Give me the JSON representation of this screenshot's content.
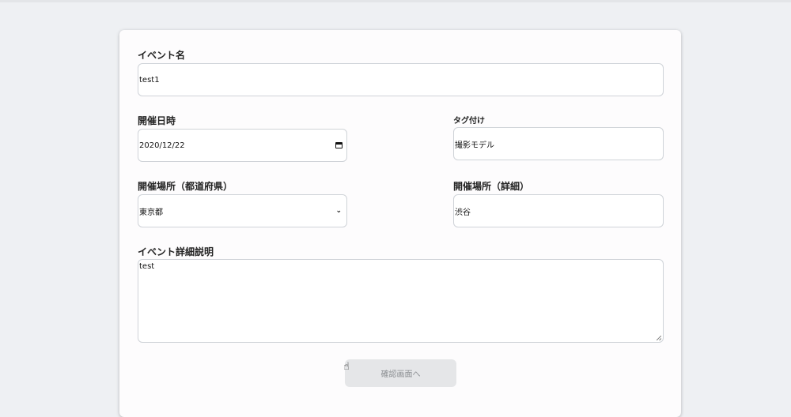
{
  "form": {
    "event_name": {
      "label": "イベント名",
      "value": "test1"
    },
    "date": {
      "label": "開催日時",
      "value": "2020/12/22",
      "icon": "calendar-icon"
    },
    "tags": {
      "label": "タグ付け",
      "value": "撮影モデル"
    },
    "prefecture": {
      "label": "開催場所（都道府県）",
      "value": "東京都",
      "icon": "chevron-down-icon"
    },
    "place_detail": {
      "label": "開催場所（詳細）",
      "value": "渋谷"
    },
    "description": {
      "label": "イベント詳細説明",
      "value": "test"
    },
    "confirm_button": {
      "label": "確認画面へ",
      "text_color": "#8a8d91",
      "bg_color": "#e5e6e8"
    }
  },
  "cursor_icon": "hand-pointer-icon"
}
